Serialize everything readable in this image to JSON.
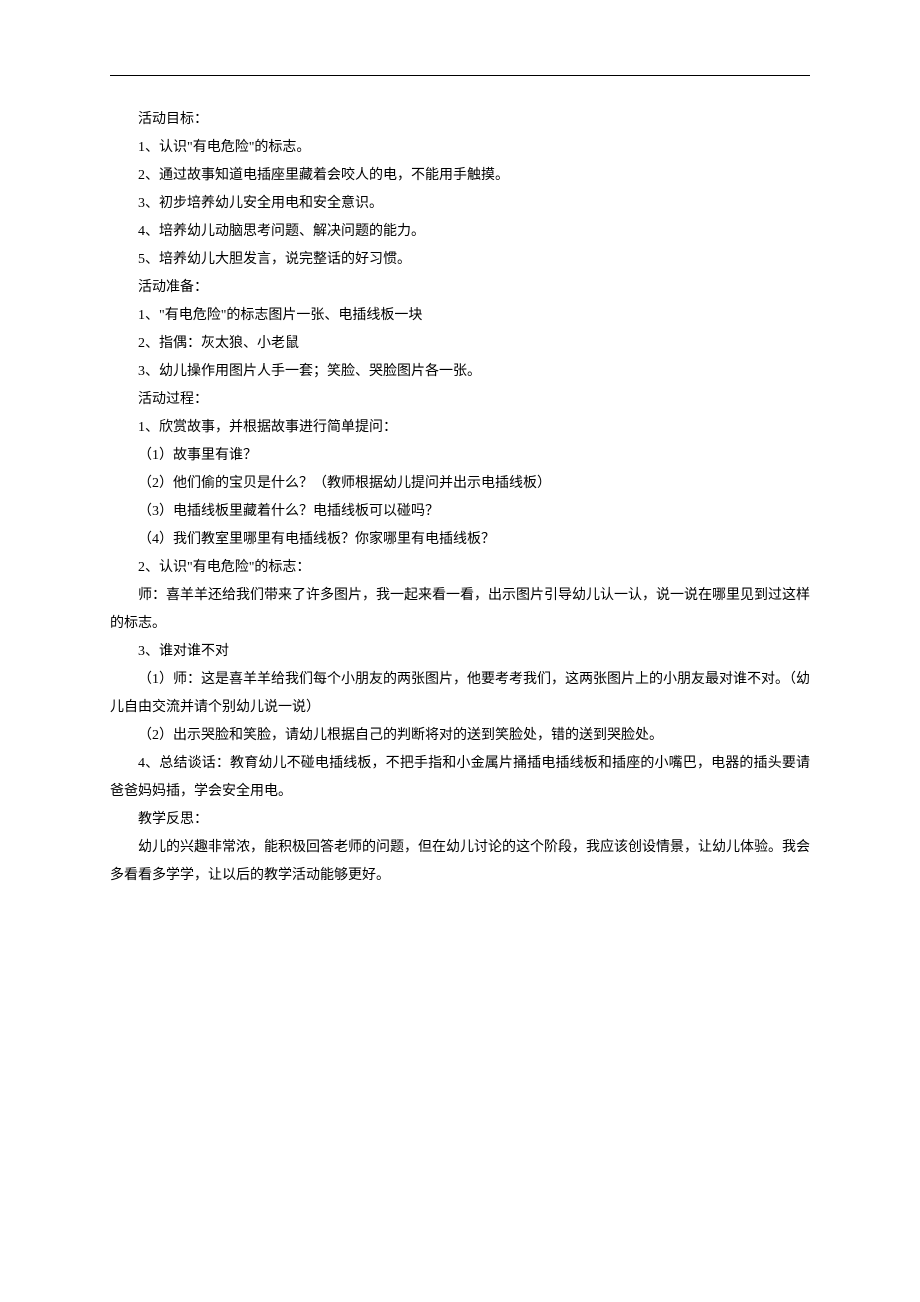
{
  "sections": {
    "goals_header": "活动目标：",
    "goals": [
      "1、认识\"有电危险\"的标志。",
      "2、通过故事知道电插座里藏着会咬人的电，不能用手触摸。",
      "3、初步培养幼儿安全用电和安全意识。",
      "4、培养幼儿动脑思考问题、解决问题的能力。",
      "5、培养幼儿大胆发言，说完整话的好习惯。"
    ],
    "prep_header": "活动准备：",
    "prep": [
      "1、\"有电危险\"的标志图片一张、电插线板一块",
      "2、指偶：灰太狼、小老鼠",
      "3、幼儿操作用图片人手一套；笑脸、哭脸图片各一张。"
    ],
    "process_header": "活动过程：",
    "process_1": "1、欣赏故事，并根据故事进行简单提问：",
    "process_1_items": [
      "（1）故事里有谁？",
      "（2）他们偷的宝贝是什么？（教师根据幼儿提问并出示电插线板）",
      "（3）电插线板里藏着什么？电插线板可以碰吗？",
      "（4）我们教室里哪里有电插线板？你家哪里有电插线板？"
    ],
    "process_2": "2、认识\"有电危险\"的标志：",
    "process_2_text": "师：喜羊羊还给我们带来了许多图片，我一起来看一看，出示图片引导幼儿认一认，说一说在哪里见到过这样的标志。",
    "process_3": "3、谁对谁不对",
    "process_3_items": [
      "（1）师：这是喜羊羊给我们每个小朋友的两张图片，他要考考我们，这两张图片上的小朋友最对谁不对。（幼儿自由交流并请个别幼儿说一说）",
      "（2）出示哭脸和笑脸，请幼儿根据自己的判断将对的送到笑脸处，错的送到哭脸处。"
    ],
    "process_4": "4、总结谈话：教育幼儿不碰电插线板，不把手指和小金属片捅插电插线板和插座的小嘴巴，电器的插头要请爸爸妈妈插，学会安全用电。",
    "reflection_header": "教学反思：",
    "reflection_text": "幼儿的兴趣非常浓，能积极回答老师的问题，但在幼儿讨论的这个阶段，我应该创设情景，让幼儿体验。我会多看看多学学，让以后的教学活动能够更好。"
  }
}
